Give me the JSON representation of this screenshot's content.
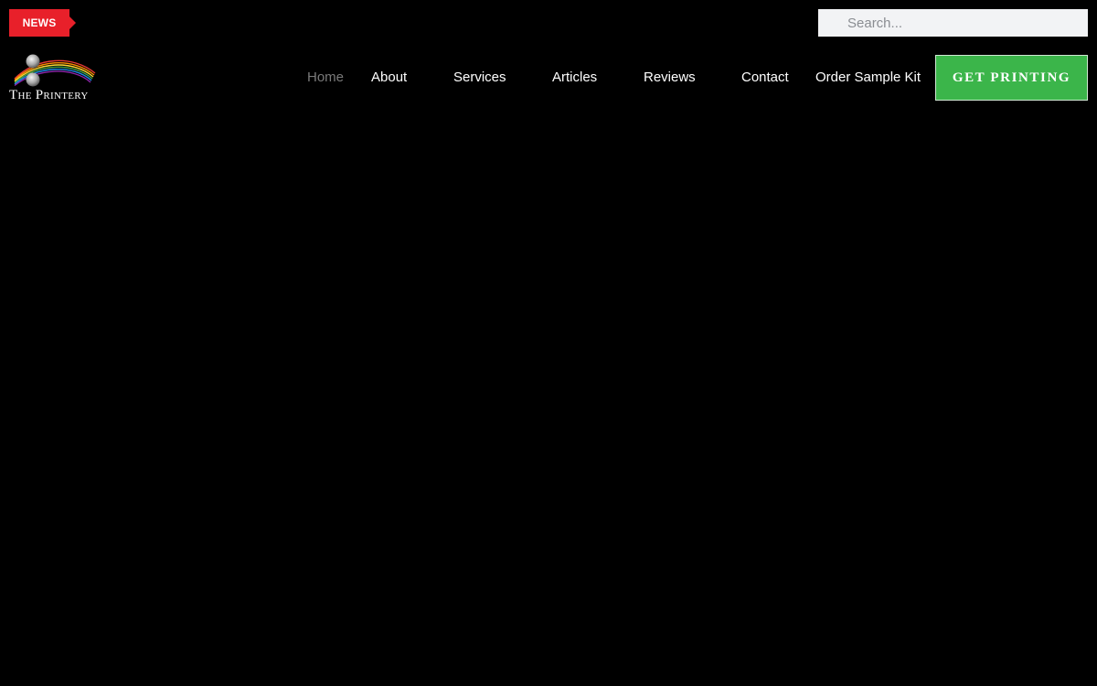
{
  "header": {
    "news_badge": "NEWS",
    "search": {
      "placeholder": "Search...",
      "value": ""
    },
    "logo": {
      "text": "The Printery",
      "icon": "rainbow-swoosh-logo-icon"
    }
  },
  "nav": {
    "items": [
      {
        "label": "Home",
        "active": true
      },
      {
        "label": "About",
        "active": false
      },
      {
        "label": "Services",
        "active": false
      },
      {
        "label": "Articles",
        "active": false
      },
      {
        "label": "Reviews",
        "active": false
      },
      {
        "label": "Contact",
        "active": false
      },
      {
        "label": "Order Sample Kit",
        "active": false
      }
    ],
    "cta_label": "GET PRINTING"
  },
  "colors": {
    "background": "#000000",
    "news_badge": "#e8202a",
    "cta": "#3bb54a",
    "nav_active": "#7a7a7a",
    "nav_text": "#ffffff",
    "search_bg": "#f2f3f5"
  }
}
